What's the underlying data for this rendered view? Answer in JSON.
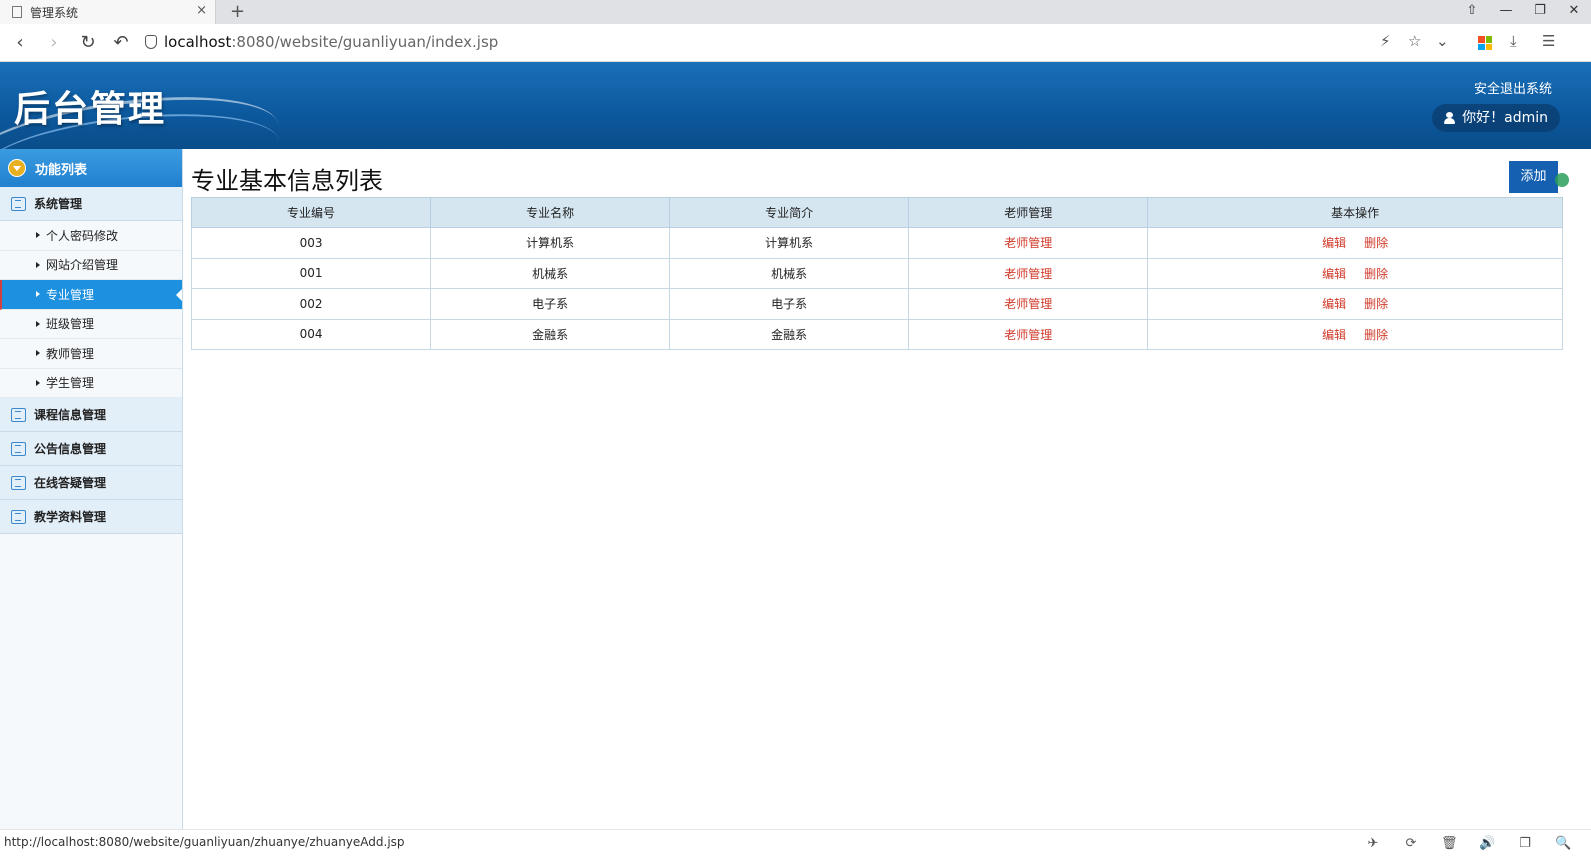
{
  "browser": {
    "tab_title": "管理系统",
    "tab_close": "×",
    "new_tab": "+",
    "url_host": "localhost",
    "url_rest": ":8080/website/guanliyuan/index.jsp",
    "window_controls": [
      "⇧",
      "—",
      "❐",
      "✕"
    ],
    "addr_right_icons": [
      "⚡",
      "☆",
      "⌄",
      "⤓",
      "☰"
    ]
  },
  "header": {
    "app_title": "后台管理",
    "logout": "安全退出系统",
    "greeting": "你好！admin"
  },
  "sidebar": {
    "head": "功能列表",
    "groups": [
      {
        "label": "系统管理"
      },
      {
        "label": "课程信息管理"
      },
      {
        "label": "公告信息管理"
      },
      {
        "label": "在线答疑管理"
      },
      {
        "label": "教学资料管理"
      }
    ],
    "subitems": [
      {
        "label": "个人密码修改"
      },
      {
        "label": "网站介绍管理"
      },
      {
        "label": "专业管理",
        "active": true
      },
      {
        "label": "班级管理"
      },
      {
        "label": "教师管理"
      },
      {
        "label": "学生管理"
      }
    ]
  },
  "main": {
    "title": "专业基本信息列表",
    "add_button": "添加",
    "columns": [
      "专业编号",
      "专业名称",
      "专业简介",
      "老师管理",
      "基本操作"
    ],
    "rows": [
      {
        "id": "003",
        "name": "计算机系",
        "intro": "计算机系",
        "teacher": "老师管理",
        "edit": "编辑",
        "delete": "删除"
      },
      {
        "id": "001",
        "name": "机械系",
        "intro": "机械系",
        "teacher": "老师管理",
        "edit": "编辑",
        "delete": "删除"
      },
      {
        "id": "002",
        "name": "电子系",
        "intro": "电子系",
        "teacher": "老师管理",
        "edit": "编辑",
        "delete": "删除"
      },
      {
        "id": "004",
        "name": "金融系",
        "intro": "金融系",
        "teacher": "老师管理",
        "edit": "编辑",
        "delete": "删除"
      }
    ]
  },
  "statusbar": {
    "url": "http://localhost:8080/website/guanliyuan/zhuanye/zhuanyeAdd.jsp",
    "icons": [
      "✈",
      "⟳",
      "🗑",
      "🔊",
      "❐",
      "🔍"
    ]
  },
  "colors": {
    "header_blue": "#0d5aa0",
    "active_blue": "#1e90e0",
    "link_red": "#d03a2a",
    "add_button": "#1560b0"
  }
}
